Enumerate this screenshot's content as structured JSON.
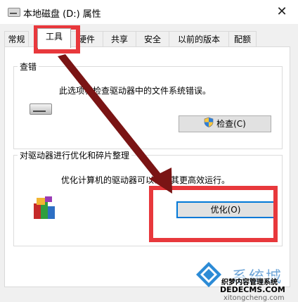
{
  "window": {
    "title": "本地磁盘 (D:) 属性",
    "close_glyph": "✕"
  },
  "tabs": [
    {
      "label": "常规"
    },
    {
      "label": "工具",
      "active": true
    },
    {
      "label": "硬件"
    },
    {
      "label": "共享"
    },
    {
      "label": "安全"
    },
    {
      "label": "以前的版本"
    },
    {
      "label": "配额"
    }
  ],
  "error_check": {
    "title": "查错",
    "description": "此选项将检查驱动器中的文件系统错误。",
    "button_label": "检查(C)",
    "icon": "drive-icon"
  },
  "optimize": {
    "title": "对驱动器进行优化和碎片整理",
    "description": "优化计算机的驱动器可以帮助其更高效运行。",
    "button_label": "优化(O)",
    "icon": "defrag-icon"
  },
  "annotations": {
    "highlight_color": "#e8383c",
    "arrow_color": "#7a1414"
  },
  "watermark": {
    "brand": "系统城",
    "line1": "织梦内容管理系统",
    "line2": "DEDECMS.COM",
    "line3": "xitongcheng.com"
  }
}
